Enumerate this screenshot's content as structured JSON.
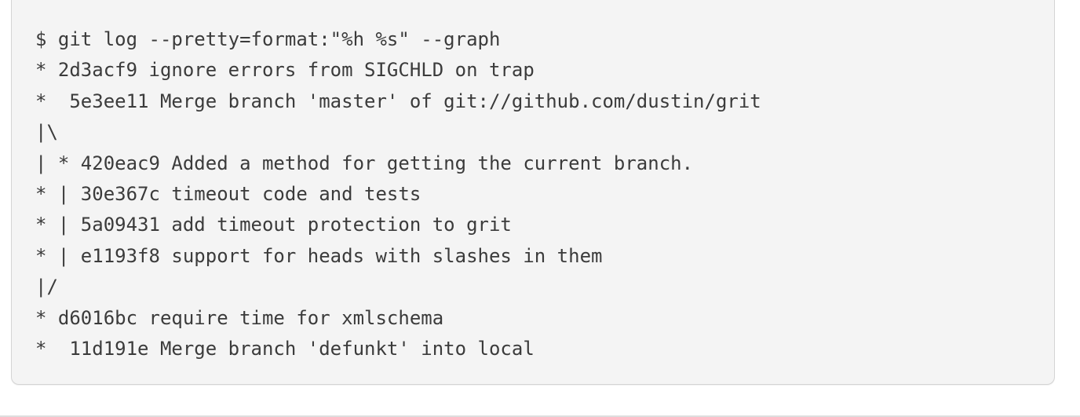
{
  "code_block": {
    "lines": [
      "$ git log --pretty=format:\"%h %s\" --graph",
      "* 2d3acf9 ignore errors from SIGCHLD on trap",
      "*  5e3ee11 Merge branch 'master' of git://github.com/dustin/grit",
      "|\\",
      "| * 420eac9 Added a method for getting the current branch.",
      "* | 30e367c timeout code and tests",
      "* | 5a09431 add timeout protection to grit",
      "* | e1193f8 support for heads with slashes in them",
      "|/",
      "* d6016bc require time for xmlschema",
      "*  11d191e Merge branch 'defunkt' into local"
    ]
  },
  "colors": {
    "block_background": "#f4f4f4",
    "block_border": "#d4d4d4",
    "text": "#3b3b3b"
  }
}
